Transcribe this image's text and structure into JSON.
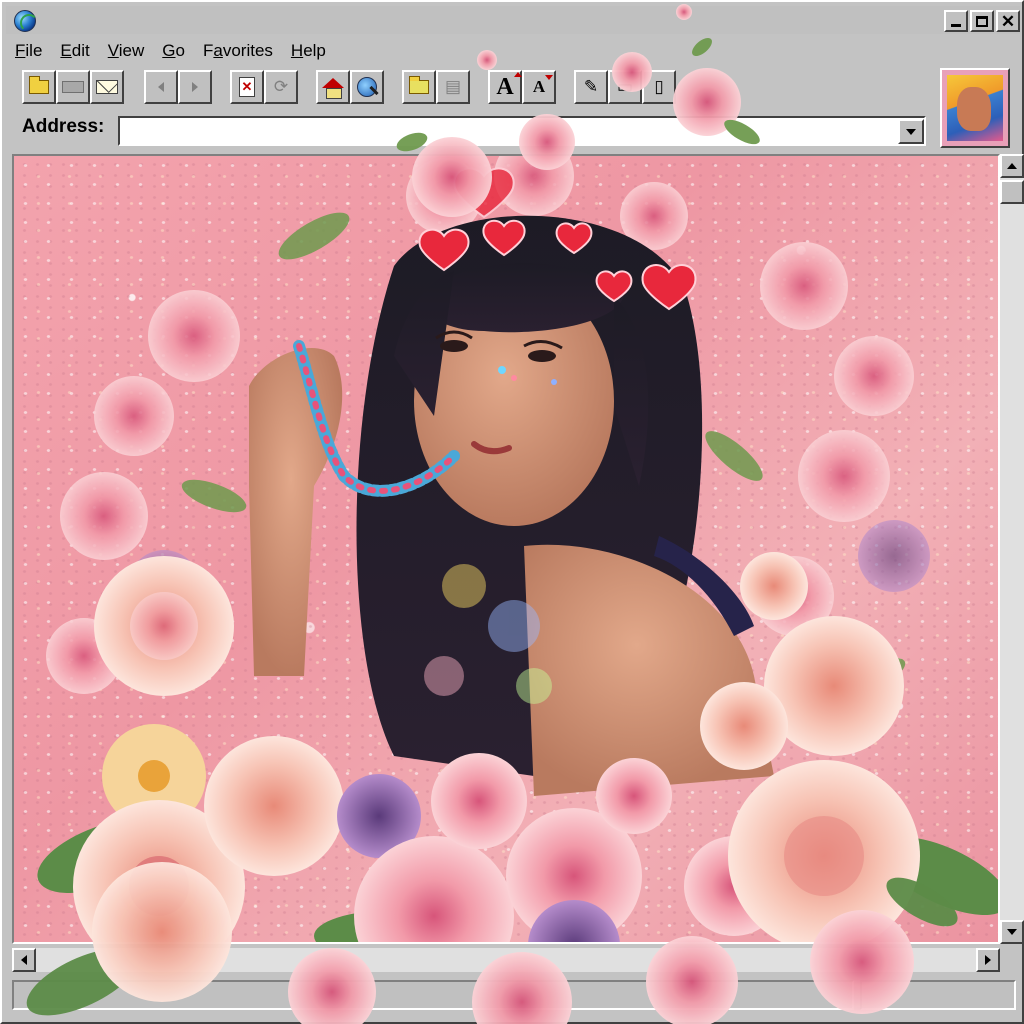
{
  "window": {
    "menus": [
      {
        "label": "File",
        "mnemonic": "F",
        "rest": "ile"
      },
      {
        "label": "Edit",
        "mnemonic": "E",
        "rest": "dit"
      },
      {
        "label": "View",
        "mnemonic": "V",
        "rest": "iew"
      },
      {
        "label": "Go",
        "mnemonic": "G",
        "rest": "o"
      },
      {
        "label": "Favorites",
        "mnemonic": "a",
        "prefix": "F",
        "rest": "vorites"
      },
      {
        "label": "Help",
        "mnemonic": "H",
        "rest": "elp"
      }
    ],
    "toolbar": {
      "font_larger_glyph": "A",
      "font_smaller_glyph": "A"
    },
    "address": {
      "label": "Address:",
      "value": ""
    }
  },
  "icons": {
    "app": "globe-icon",
    "minimize": "minimize-icon",
    "maximize": "maximize-icon",
    "close": "close-icon",
    "open": "folder-open-icon",
    "print": "printer-icon",
    "mail": "mail-icon",
    "back": "back-arrow-icon",
    "forward": "forward-arrow-icon",
    "stop": "stop-icon",
    "refresh": "refresh-icon",
    "home": "home-icon",
    "search": "search-globe-icon",
    "favorites": "favorites-folder-icon",
    "history": "history-icon",
    "font_larger": "font-larger-icon",
    "font_smaller": "font-smaller-icon"
  },
  "colors": {
    "chrome": "#c0c0c0",
    "glitter_bg": "#f0a0aa",
    "rose": "#f4a7b4",
    "heart": "#e8283c",
    "hair": "#1c1a22"
  }
}
